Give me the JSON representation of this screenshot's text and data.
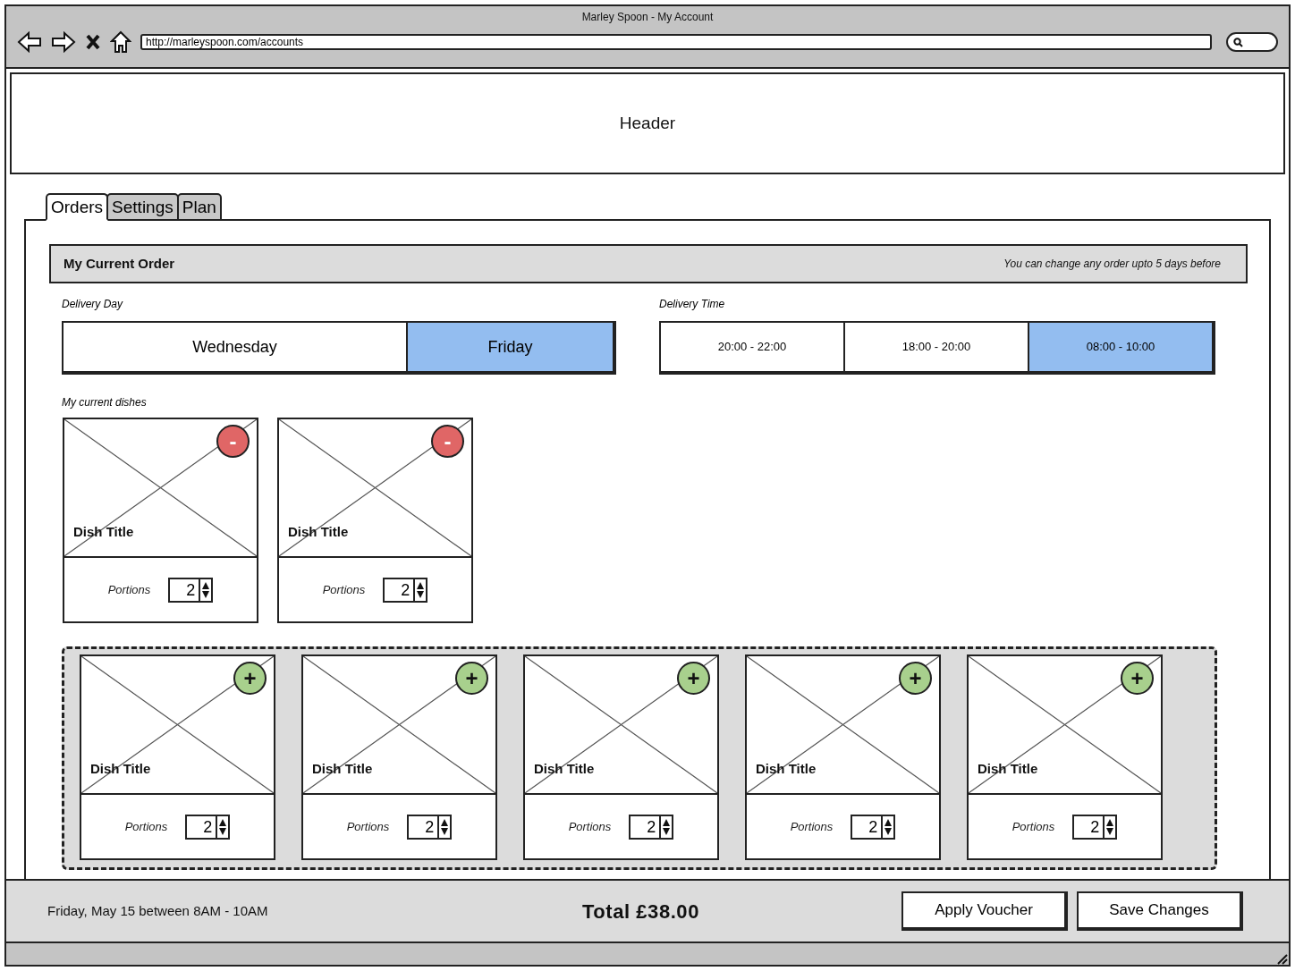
{
  "browser": {
    "title": "Marley Spoon - My Account",
    "url": "http://marleyspoon.com/accounts"
  },
  "header": {
    "text": "Header"
  },
  "tabs": [
    {
      "label": "Orders",
      "selected": true
    },
    {
      "label": "Settings",
      "selected": false
    },
    {
      "label": "Plan",
      "selected": false
    }
  ],
  "order_bar": {
    "title": "My Current Order",
    "note": "You can change any order upto 5 days before"
  },
  "delivery_day": {
    "label": "Delivery Day",
    "options": [
      {
        "label": "Wednesday",
        "selected": false
      },
      {
        "label": "Friday",
        "selected": true
      }
    ]
  },
  "delivery_time": {
    "label": "Delivery Time",
    "options": [
      {
        "label": "20:00 - 22:00",
        "selected": false
      },
      {
        "label": "18:00 - 20:00",
        "selected": false
      },
      {
        "label": "08:00 - 10:00",
        "selected": true
      }
    ]
  },
  "current_dishes": {
    "label": "My current dishes",
    "dishes": [
      {
        "kind": "remove",
        "action": "-",
        "title": "Dish Title",
        "portions_label": "Portions",
        "portions": "2"
      },
      {
        "kind": "remove",
        "action": "-",
        "title": "Dish Title",
        "portions_label": "Portions",
        "portions": "2"
      }
    ]
  },
  "suggested_dishes": [
    {
      "kind": "add",
      "action": "+",
      "title": "Dish Title",
      "portions_label": "Portions",
      "portions": "2"
    },
    {
      "kind": "add",
      "action": "+",
      "title": "Dish Title",
      "portions_label": "Portions",
      "portions": "2"
    },
    {
      "kind": "add",
      "action": "+",
      "title": "Dish Title",
      "portions_label": "Portions",
      "portions": "2"
    },
    {
      "kind": "add",
      "action": "+",
      "title": "Dish Title",
      "portions_label": "Portions",
      "portions": "2"
    },
    {
      "kind": "add",
      "action": "+",
      "title": "Dish Title",
      "portions_label": "Portions",
      "portions": "2"
    }
  ],
  "footer": {
    "summary": "Friday, May 15 between 8AM - 10AM",
    "total": "Total £38.00",
    "buttons": [
      "Apply Voucher",
      "Save Changes"
    ]
  }
}
